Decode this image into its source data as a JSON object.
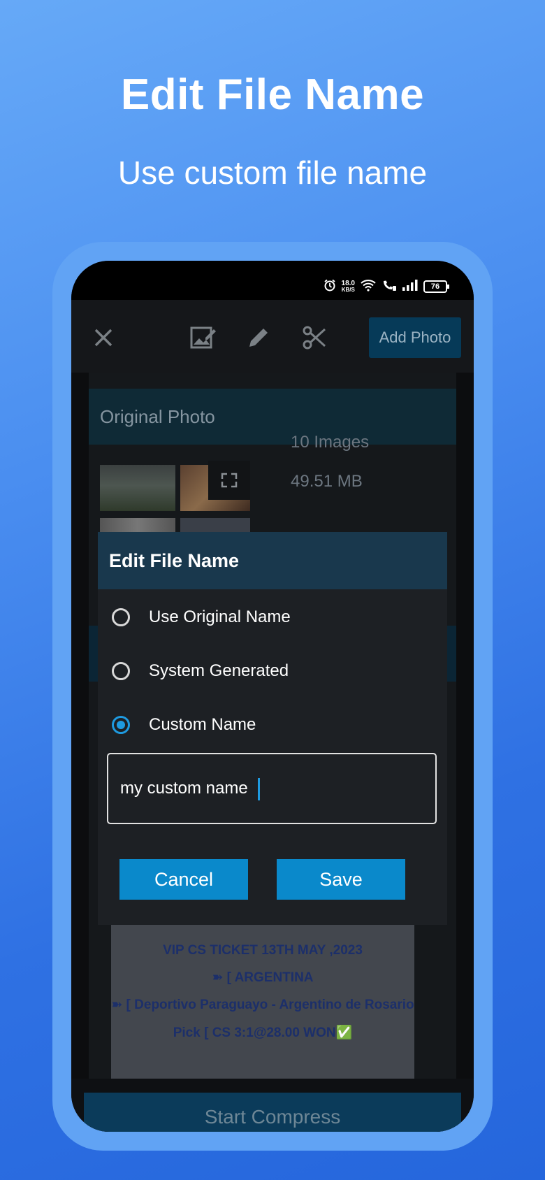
{
  "promo": {
    "title": "Edit File Name",
    "subtitle": "Use custom file name"
  },
  "status_bar": {
    "net_speed_value": "18.0",
    "net_speed_unit": "KB/S",
    "battery": "76"
  },
  "toolbar": {
    "close_icon": "close-icon",
    "add_photo_label": "Add Photo"
  },
  "original_photo": {
    "header": "Original Photo",
    "image_count": "10 Images",
    "total_size": "49.51 MB"
  },
  "ticket_preview": {
    "lines": [
      "VIP CS TICKET 13TH MAY ,2023",
      "➽ [ ARGENTINA",
      "➽ [ Deportivo Paraguayo - Argentino de Rosario",
      "Pick [ CS 3:1@28.00 WON✅"
    ]
  },
  "start_compress_label": "Start Compress",
  "dialog": {
    "title": "Edit File Name",
    "options": [
      {
        "label": "Use Original Name",
        "selected": false
      },
      {
        "label": "System Generated",
        "selected": false
      },
      {
        "label": "Custom Name",
        "selected": true
      }
    ],
    "custom_name_value": "my custom name",
    "cancel_label": "Cancel",
    "save_label": "Save"
  },
  "colors": {
    "accent": "#0a89cb",
    "radio_selected": "#1e9ae0",
    "dialog_header": "#19384d"
  }
}
